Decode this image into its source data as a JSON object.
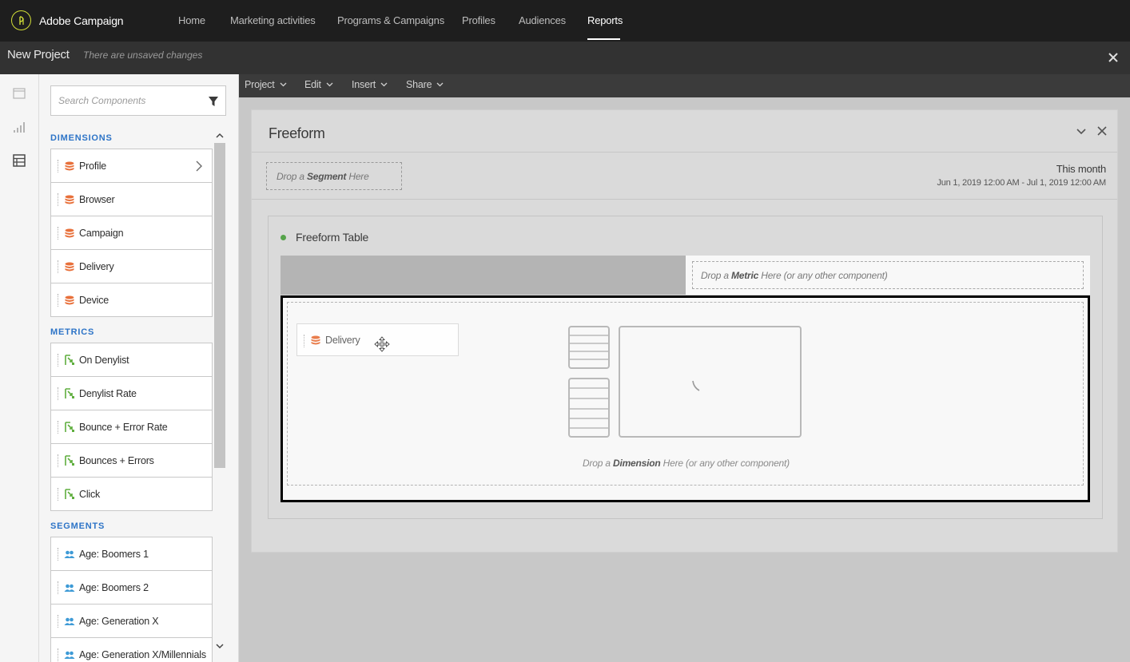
{
  "app": {
    "name": "Adobe Campaign"
  },
  "nav": {
    "items": [
      {
        "label": "Home",
        "active": false
      },
      {
        "label": "Marketing activities",
        "active": false
      },
      {
        "label": "Programs & Campaigns",
        "active": false
      },
      {
        "label": "Profiles",
        "active": false
      },
      {
        "label": "Audiences",
        "active": false
      },
      {
        "label": "Reports",
        "active": true
      }
    ]
  },
  "project": {
    "title": "New Project",
    "status": "There are unsaved changes"
  },
  "components": {
    "search_placeholder": "Search Components",
    "dimensions": {
      "heading": "DIMENSIONS",
      "items": [
        "Profile",
        "Browser",
        "Campaign",
        "Delivery",
        "Device"
      ]
    },
    "metrics": {
      "heading": "METRICS",
      "items": [
        "On Denylist",
        "Denylist Rate",
        "Bounce + Error Rate",
        "Bounces + Errors",
        "Click"
      ]
    },
    "segments": {
      "heading": "SEGMENTS",
      "items": [
        "Age: Boomers 1",
        "Age: Boomers 2",
        "Age: Generation X",
        "Age: Generation X/Millennials"
      ]
    }
  },
  "toolbar": {
    "menus": [
      "Project",
      "Edit",
      "Insert",
      "Share"
    ]
  },
  "freeform": {
    "title": "Freeform",
    "segment_drop": {
      "prefix": "Drop a ",
      "keyword": "Segment",
      "suffix": " Here"
    },
    "date": {
      "title": "This month",
      "range": "Jun 1, 2019 12:00 AM - Jul 1, 2019 12:00 AM"
    },
    "table": {
      "title": "Freeform Table",
      "metric_drop": {
        "prefix": "Drop a ",
        "keyword": "Metric",
        "suffix": " Here (or any other component)"
      },
      "dimension_drop": {
        "prefix": "Drop a ",
        "keyword": "Dimension",
        "suffix": " Here (or any other component)"
      },
      "dragging_item": "Delivery"
    }
  },
  "colors": {
    "brand_accent": "#d2de37",
    "section_heading": "#2d74c7",
    "dimension_icon": "#e8703a",
    "metric_icon": "#5fae3e",
    "segment_icon": "#3d9ad6",
    "table_dot": "#55a34a"
  },
  "icons": {
    "logo": "adobe-campaign-logo",
    "rail": [
      "panels-icon",
      "visualizations-icon",
      "components-icon"
    ],
    "search_filter": "filter-icon",
    "dimension": "dimension-stack-icon",
    "metric": "metric-icon",
    "segment": "segment-people-icon"
  }
}
